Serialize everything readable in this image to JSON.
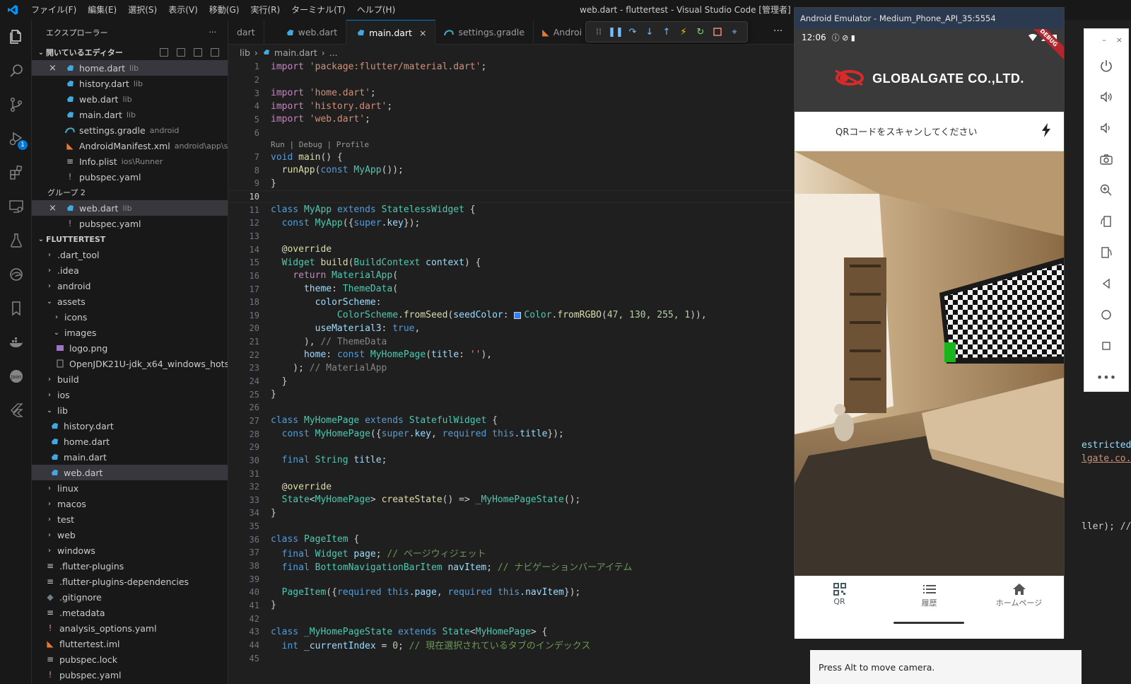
{
  "window": {
    "title": "web.dart - fluttertest - Visual Studio Code [管理者]",
    "menu": [
      "ファイル(F)",
      "編集(E)",
      "選択(S)",
      "表示(V)",
      "移動(G)",
      "実行(R)",
      "ターミナル(T)",
      "ヘルプ(H)"
    ]
  },
  "activity": {
    "debug_badge": "1"
  },
  "sidebar": {
    "title": "エクスプローラー",
    "more": "···",
    "open_editors_label": "開いているエディター",
    "group1": [
      {
        "name": "home.dart",
        "desc": "lib",
        "icon": "dart-icon"
      },
      {
        "name": "history.dart",
        "desc": "lib",
        "icon": "dart-icon"
      },
      {
        "name": "web.dart",
        "desc": "lib",
        "icon": "dart-icon"
      },
      {
        "name": "main.dart",
        "desc": "lib",
        "icon": "dart-icon"
      },
      {
        "name": "settings.gradle",
        "desc": "android",
        "icon": "gradle-icon"
      },
      {
        "name": "AndroidManifest.xml",
        "desc": "android\\app\\s...",
        "icon": "rss-icon"
      },
      {
        "name": "Info.plist",
        "desc": "ios\\Runner",
        "icon": "list-icon"
      },
      {
        "name": "pubspec.yaml",
        "desc": "",
        "icon": "yaml-icon"
      }
    ],
    "group2_label": "グループ 2",
    "group2": [
      {
        "name": "web.dart",
        "desc": "lib",
        "icon": "dart-icon"
      },
      {
        "name": "pubspec.yaml",
        "desc": "",
        "icon": "yaml-icon"
      }
    ],
    "project_label": "FLUTTERTEST",
    "tree": {
      "dart_tool": ".dart_tool",
      "idea": ".idea",
      "android": "android",
      "assets": "assets",
      "icons": "icons",
      "images": "images",
      "logo": "logo.png",
      "openjdk": "OpenJDK21U-jdk_x64_windows_hots...",
      "build": "build",
      "ios": "ios",
      "lib": "lib",
      "history": "history.dart",
      "home": "home.dart",
      "main": "main.dart",
      "web": "web.dart",
      "linux": "linux",
      "macos": "macos",
      "test": "test",
      "webdir": "web",
      "windows": "windows",
      "fp": ".flutter-plugins",
      "fpd": ".flutter-plugins-dependencies",
      "gitignore": ".gitignore",
      "metadata": ".metadata",
      "analysis": "analysis_options.yaml",
      "iml": "fluttertest.iml",
      "lock": "pubspec.lock",
      "pubspec": "pubspec.yaml"
    }
  },
  "tabs": [
    {
      "label": "dart",
      "active": false
    },
    {
      "label": "web.dart",
      "active": false
    },
    {
      "label": "main.dart",
      "active": true
    },
    {
      "label": "settings.gradle",
      "active": false
    },
    {
      "label": "Androi",
      "active": false
    }
  ],
  "breadcrumb": {
    "folder": "lib",
    "file": "main.dart",
    "more": "..."
  },
  "editor": {
    "codelens": "Run | Debug | Profile",
    "lines": {
      "l1_str": "'package:flutter/material.dart'",
      "l3_str": "'home.dart'",
      "l4_str": "'history.dart'",
      "l5_str": "'web.dart'",
      "c21": "// ThemeData",
      "c23": "// MaterialApp",
      "c37": "// ページウィジェット",
      "c38": "// ナビゲーションバーアイテム",
      "c44": "// 現在選択されているタブのインデックス",
      "rgbo": "47, 130, 255, 1",
      "title_str": "''",
      "idx": "0"
    }
  },
  "emulator": {
    "title": "Android Emulator - Medium_Phone_API_35:5554",
    "time": "12:06",
    "debug_ribbon": "DEBUG",
    "brand": "GLOBALGATE CO.,LTD.",
    "scan_prompt": "QRコードをスキャンしてください",
    "nav": [
      {
        "label": "QR",
        "icon": "qr-icon"
      },
      {
        "label": "履歴",
        "icon": "list-icon"
      },
      {
        "label": "ホームページ",
        "icon": "home-icon"
      }
    ],
    "toast": "Press Alt to move camera.",
    "side_controls": [
      "–",
      "×"
    ]
  },
  "peek_text": {
    "a": "estricted",
    "b": "lgate.co.",
    "c": "ller); //"
  },
  "colors": {
    "accent": "#0078d4",
    "seed": "#2f82ff",
    "appbar": "#3a3a3a"
  }
}
